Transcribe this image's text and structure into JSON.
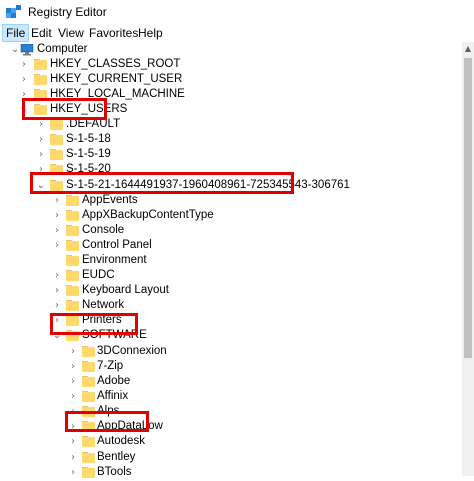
{
  "window": {
    "title": "Registry Editor",
    "icon": "registry-editor-icon"
  },
  "menu": {
    "items": [
      "File",
      "Edit",
      "View",
      "Favorites",
      "Help"
    ],
    "active": "File"
  },
  "tree": {
    "root": "Computer",
    "hives": [
      "HKEY_CLASSES_ROOT",
      "HKEY_CURRENT_USER",
      "HKEY_LOCAL_MACHINE",
      "HKEY_USERS"
    ],
    "hkey_users_children": [
      ".DEFAULT",
      "S-1-5-18",
      "S-1-5-19",
      "S-1-5-20",
      "S-1-5-21-1644491937-1960408961-725345543-306761"
    ],
    "sid_children": [
      "AppEvents",
      "AppXBackupContentType",
      "Console",
      "Control Panel",
      "Environment",
      "EUDC",
      "Keyboard Layout",
      "Network",
      "Printers",
      "SOFTWARE"
    ],
    "software_children": [
      "3DConnexion",
      "7-Zip",
      "Adobe",
      "Affinix",
      "Alps",
      "AppDataLow",
      "Autodesk",
      "Bentley",
      "BTools"
    ],
    "highlighted": [
      "HKEY_USERS",
      "S-1-5-21-1644491937-1960408961-725345543-306761",
      "SOFTWARE",
      "Autodesk"
    ]
  },
  "colors": {
    "highlight_border": "#e00000",
    "folder": "#ffd96b",
    "menu_active": "#cce8ff"
  }
}
